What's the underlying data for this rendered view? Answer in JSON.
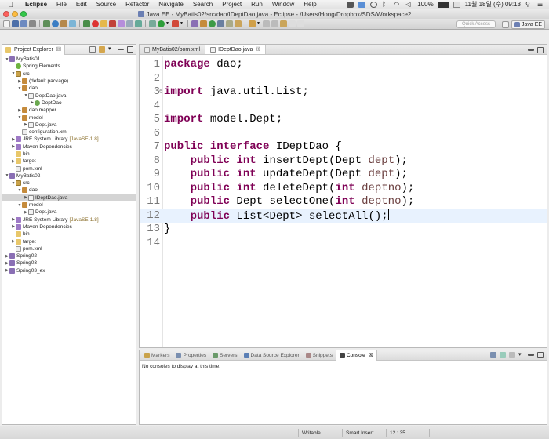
{
  "menubar": {
    "app_name": "Eclipse",
    "items": [
      "File",
      "Edit",
      "Source",
      "Refactor",
      "Navigate",
      "Search",
      "Project",
      "Run",
      "Window",
      "Help"
    ],
    "battery": "100%",
    "datetime": "11월 18일 (수)  09:13"
  },
  "window": {
    "title": "Java EE - MyBatis02/src/dao/IDeptDao.java - Eclipse - /Users/Hong/Dropbox/SDS/Workspace2"
  },
  "toolbar": {
    "quick_access_placeholder": "Quick Access",
    "perspective_label": "Java EE"
  },
  "explorer": {
    "tab_label": "Project Explorer",
    "tab_close": "☒",
    "tree": [
      {
        "label": "MyBatis01",
        "icon": "project-icon",
        "depth": 0,
        "twisty": "▼"
      },
      {
        "label": "Spring Elements",
        "icon": "spring-icon",
        "depth": 1,
        "twisty": ""
      },
      {
        "label": "src",
        "icon": "source-folder-icon",
        "depth": 1,
        "twisty": "▼"
      },
      {
        "label": "(default package)",
        "icon": "package-icon",
        "depth": 2,
        "twisty": "▶"
      },
      {
        "label": "dao",
        "icon": "package-icon",
        "depth": 2,
        "twisty": "▼"
      },
      {
        "label": "DeptDao.java",
        "icon": "java-file-icon",
        "depth": 3,
        "twisty": "▼"
      },
      {
        "label": "DeptDao",
        "icon": "class-icon",
        "depth": 4,
        "twisty": "▶"
      },
      {
        "label": "dao.mapper",
        "icon": "package-icon",
        "depth": 2,
        "twisty": "▶"
      },
      {
        "label": "model",
        "icon": "package-icon",
        "depth": 2,
        "twisty": "▼"
      },
      {
        "label": "Dept.java",
        "icon": "java-file-icon",
        "depth": 3,
        "twisty": "▶"
      },
      {
        "label": "configuration.xml",
        "icon": "xml-file-icon",
        "depth": 2,
        "twisty": ""
      },
      {
        "label": "JRE System Library",
        "suffix": "[JavaSE-1.8]",
        "icon": "library-icon",
        "depth": 1,
        "twisty": "▶"
      },
      {
        "label": "Maven Dependencies",
        "icon": "library-icon",
        "depth": 1,
        "twisty": "▶"
      },
      {
        "label": "bin",
        "icon": "folder-icon",
        "depth": 1,
        "twisty": ""
      },
      {
        "label": "target",
        "icon": "folder-icon",
        "depth": 1,
        "twisty": "▶"
      },
      {
        "label": "pom.xml",
        "icon": "xml-file-icon",
        "depth": 1,
        "twisty": ""
      },
      {
        "label": "MyBatis02",
        "icon": "project-icon",
        "depth": 0,
        "twisty": "▼"
      },
      {
        "label": "src",
        "icon": "source-folder-icon",
        "depth": 1,
        "twisty": "▼"
      },
      {
        "label": "dao",
        "icon": "package-icon",
        "depth": 2,
        "twisty": "▼"
      },
      {
        "label": "IDeptDao.java",
        "icon": "java-file-icon",
        "depth": 3,
        "twisty": "▶",
        "selected": true
      },
      {
        "label": "model",
        "icon": "package-icon",
        "depth": 2,
        "twisty": "▼"
      },
      {
        "label": "Dept.java",
        "icon": "java-file-icon",
        "depth": 3,
        "twisty": "▶"
      },
      {
        "label": "JRE System Library",
        "suffix": "[JavaSE-1.8]",
        "icon": "library-icon",
        "depth": 1,
        "twisty": "▶"
      },
      {
        "label": "Maven Dependencies",
        "icon": "library-icon",
        "depth": 1,
        "twisty": "▶"
      },
      {
        "label": "bin",
        "icon": "folder-icon",
        "depth": 1,
        "twisty": ""
      },
      {
        "label": "target",
        "icon": "folder-icon",
        "depth": 1,
        "twisty": "▶"
      },
      {
        "label": "pom.xml",
        "icon": "xml-file-icon",
        "depth": 1,
        "twisty": ""
      },
      {
        "label": "Spring02",
        "icon": "project-icon",
        "depth": 0,
        "twisty": "▶"
      },
      {
        "label": "Spring03",
        "icon": "project-icon",
        "depth": 0,
        "twisty": "▶"
      },
      {
        "label": "Spring03_ex",
        "icon": "project-icon",
        "depth": 0,
        "twisty": "▶"
      }
    ]
  },
  "editor": {
    "tabs": [
      {
        "label": "MyBatis02/pom.xml",
        "active": false
      },
      {
        "label": "IDeptDao.java",
        "active": true,
        "close": "☒"
      }
    ],
    "current_line": 12,
    "lines": [
      {
        "n": "1",
        "tokens": [
          {
            "t": "package",
            "c": "kw"
          },
          {
            "t": " dao;",
            "c": ""
          }
        ]
      },
      {
        "n": "2",
        "tokens": []
      },
      {
        "n": "3",
        "fold": "⊖",
        "tokens": [
          {
            "t": "import",
            "c": "kw"
          },
          {
            "t": " java.util.List;",
            "c": ""
          }
        ]
      },
      {
        "n": "4",
        "tokens": []
      },
      {
        "n": "5",
        "tokens": [
          {
            "t": "import",
            "c": "kw"
          },
          {
            "t": " model.Dept;",
            "c": ""
          }
        ]
      },
      {
        "n": "6",
        "tokens": []
      },
      {
        "n": "7",
        "tokens": [
          {
            "t": "public",
            "c": "kw"
          },
          {
            "t": " ",
            "c": ""
          },
          {
            "t": "interface",
            "c": "kw"
          },
          {
            "t": " IDeptDao {",
            "c": ""
          }
        ]
      },
      {
        "n": "8",
        "tokens": [
          {
            "t": "    ",
            "c": ""
          },
          {
            "t": "public",
            "c": "kw"
          },
          {
            "t": " ",
            "c": ""
          },
          {
            "t": "int",
            "c": "kw"
          },
          {
            "t": " insertDept(Dept ",
            "c": ""
          },
          {
            "t": "dept",
            "c": "param"
          },
          {
            "t": ");",
            "c": ""
          }
        ]
      },
      {
        "n": "9",
        "tokens": [
          {
            "t": "    ",
            "c": ""
          },
          {
            "t": "public",
            "c": "kw"
          },
          {
            "t": " ",
            "c": ""
          },
          {
            "t": "int",
            "c": "kw"
          },
          {
            "t": " updateDept(Dept ",
            "c": ""
          },
          {
            "t": "dept",
            "c": "param"
          },
          {
            "t": ");",
            "c": ""
          }
        ]
      },
      {
        "n": "10",
        "tokens": [
          {
            "t": "    ",
            "c": ""
          },
          {
            "t": "public",
            "c": "kw"
          },
          {
            "t": " ",
            "c": ""
          },
          {
            "t": "int",
            "c": "kw"
          },
          {
            "t": " deleteDept(",
            "c": ""
          },
          {
            "t": "int",
            "c": "kw"
          },
          {
            "t": " ",
            "c": ""
          },
          {
            "t": "deptno",
            "c": "param"
          },
          {
            "t": ");",
            "c": ""
          }
        ]
      },
      {
        "n": "11",
        "tokens": [
          {
            "t": "    ",
            "c": ""
          },
          {
            "t": "public",
            "c": "kw"
          },
          {
            "t": " Dept selectOne(",
            "c": ""
          },
          {
            "t": "int",
            "c": "kw"
          },
          {
            "t": " ",
            "c": ""
          },
          {
            "t": "deptno",
            "c": "param"
          },
          {
            "t": ");",
            "c": ""
          }
        ]
      },
      {
        "n": "12",
        "tokens": [
          {
            "t": "    ",
            "c": ""
          },
          {
            "t": "public",
            "c": "kw"
          },
          {
            "t": " List<Dept> selectAll();",
            "c": ""
          }
        ]
      },
      {
        "n": "13",
        "tokens": [
          {
            "t": "}",
            "c": ""
          }
        ]
      },
      {
        "n": "14",
        "tokens": []
      }
    ]
  },
  "bottom": {
    "tabs": [
      {
        "label": "Markers",
        "icon": "markers-icon",
        "active": false
      },
      {
        "label": "Properties",
        "icon": "properties-icon",
        "active": false
      },
      {
        "label": "Servers",
        "icon": "servers-icon",
        "active": false
      },
      {
        "label": "Data Source Explorer",
        "icon": "datasource-icon",
        "active": false
      },
      {
        "label": "Snippets",
        "icon": "snippets-icon",
        "active": false
      },
      {
        "label": "Console",
        "icon": "console-icon",
        "active": true,
        "close": "☒"
      }
    ],
    "console_message": "No consoles to display at this time."
  },
  "statusbar": {
    "writable": "Writable",
    "insert_mode": "Smart Insert",
    "position": "12 : 35"
  },
  "colors": {
    "keyword": "#7f0055",
    "param": "#6a3e3e",
    "current_line": "#e8f2fe",
    "selection": "#d4d4d4"
  }
}
